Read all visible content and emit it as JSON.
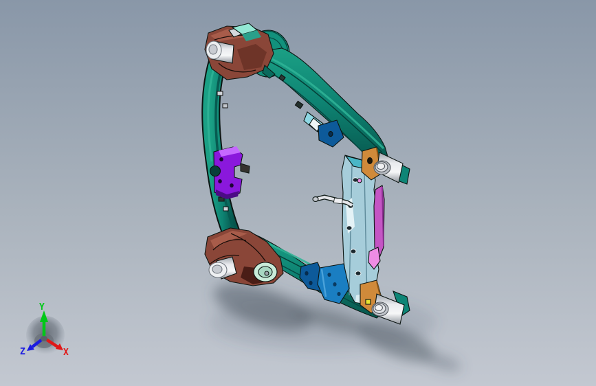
{
  "triad": {
    "label_x": "X",
    "label_y": "Y",
    "label_z": "Z",
    "color_x": "#e01818",
    "color_y": "#00c818",
    "color_z": "#1c1ce0"
  },
  "palette": {
    "background_top": "#8997a8",
    "background_mid": "#aab3bd",
    "background_bottom": "#c3c8d1",
    "teal": "#0e8576",
    "teal_dark": "#075b51",
    "teal_light": "#2fb496",
    "mint": "#c9ecd9",
    "brown": "#8a4638",
    "brown_dark": "#5c291f",
    "brown_light": "#a85c4a",
    "purple": "#8a18dc",
    "purple_light": "#c568ff",
    "purple_dark": "#4c0c86",
    "magenta": "#c455c4",
    "pink": "#ee8ce4",
    "pale_blue": "#a6cdda",
    "blue": "#1a7ec2",
    "blue_dark": "#0d5a9a",
    "orange": "#d08a3a",
    "yellow": "#e8e430",
    "silver": "#d6d6da",
    "silver_light": "#f2f2f4",
    "shadow": "#4a5560"
  }
}
